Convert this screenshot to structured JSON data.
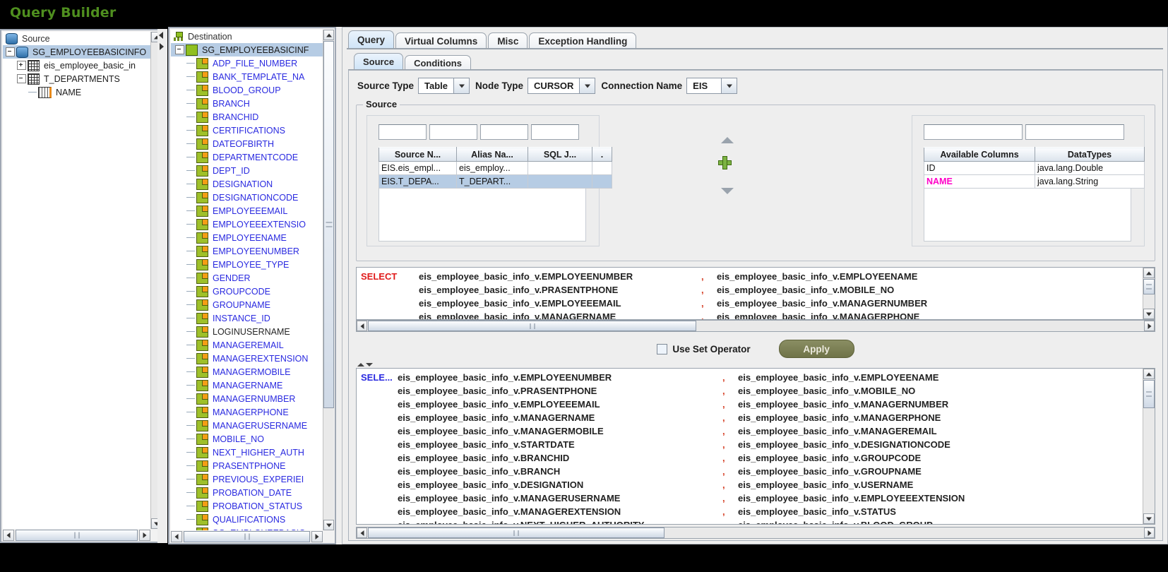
{
  "window": {
    "title": "Query Builder",
    "title_color": "#4f8f1f"
  },
  "source_panel": {
    "header": "Source",
    "nodes": [
      {
        "label": "SG_EMPLOYEEBASICINFO",
        "icon": "database-icon",
        "depth": 1,
        "expander": "minus",
        "selected": true
      },
      {
        "label": "eis_employee_basic_in",
        "icon": "table-icon",
        "depth": 2,
        "expander": "plus",
        "selected": false
      },
      {
        "label": "T_DEPARTMENTS",
        "icon": "table-icon",
        "depth": 2,
        "expander": "minus",
        "selected": false
      },
      {
        "label": "NAME",
        "icon": "column-icon",
        "depth": 3,
        "expander": "none",
        "selected": false
      }
    ]
  },
  "destination_panel": {
    "header": "Destination",
    "root": {
      "label": "SG_EMPLOYEEBASICINF",
      "selected": true
    },
    "columns": [
      {
        "label": "ADP_FILE_NUMBER",
        "color": "blue"
      },
      {
        "label": "BANK_TEMPLATE_NA",
        "color": "blue"
      },
      {
        "label": "BLOOD_GROUP",
        "color": "blue"
      },
      {
        "label": "BRANCH",
        "color": "blue"
      },
      {
        "label": "BRANCHID",
        "color": "blue"
      },
      {
        "label": "CERTIFICATIONS",
        "color": "blue"
      },
      {
        "label": "DATEOFBIRTH",
        "color": "blue"
      },
      {
        "label": "DEPARTMENTCODE",
        "color": "blue"
      },
      {
        "label": "DEPT_ID",
        "color": "blue"
      },
      {
        "label": "DESIGNATION",
        "color": "blue"
      },
      {
        "label": "DESIGNATIONCODE",
        "color": "blue"
      },
      {
        "label": "EMPLOYEEEMAIL",
        "color": "blue"
      },
      {
        "label": "EMPLOYEEEXTENSIO",
        "color": "blue"
      },
      {
        "label": "EMPLOYEENAME",
        "color": "blue"
      },
      {
        "label": "EMPLOYEENUMBER",
        "color": "blue"
      },
      {
        "label": "EMPLOYEE_TYPE",
        "color": "blue"
      },
      {
        "label": "GENDER",
        "color": "blue"
      },
      {
        "label": "GROUPCODE",
        "color": "blue"
      },
      {
        "label": "GROUPNAME",
        "color": "blue"
      },
      {
        "label": "INSTANCE_ID",
        "color": "blue"
      },
      {
        "label": "LOGINUSERNAME",
        "color": "black"
      },
      {
        "label": "MANAGEREMAIL",
        "color": "blue"
      },
      {
        "label": "MANAGEREXTENSION",
        "color": "blue"
      },
      {
        "label": "MANAGERMOBILE",
        "color": "blue"
      },
      {
        "label": "MANAGERNAME",
        "color": "blue"
      },
      {
        "label": "MANAGERNUMBER",
        "color": "blue"
      },
      {
        "label": "MANAGERPHONE",
        "color": "blue"
      },
      {
        "label": "MANAGERUSERNAME",
        "color": "blue"
      },
      {
        "label": "MOBILE_NO",
        "color": "blue"
      },
      {
        "label": "NEXT_HIGHER_AUTH",
        "color": "blue"
      },
      {
        "label": "PRASENTPHONE",
        "color": "blue"
      },
      {
        "label": "PREVIOUS_EXPERIEI",
        "color": "blue"
      },
      {
        "label": "PROBATION_DATE",
        "color": "blue"
      },
      {
        "label": "PROBATION_STATUS",
        "color": "blue"
      },
      {
        "label": "QUALIFICATIONS",
        "color": "blue"
      },
      {
        "label": "SG_EMPLOYEEBASIC",
        "color": "blue"
      }
    ]
  },
  "main": {
    "tabs": [
      {
        "label": "Query",
        "active": true
      },
      {
        "label": "Virtual Columns",
        "active": false
      },
      {
        "label": "Misc",
        "active": false
      },
      {
        "label": "Exception Handling",
        "active": false
      }
    ],
    "subtabs": [
      {
        "label": "Source",
        "active": true
      },
      {
        "label": "Conditions",
        "active": false
      }
    ],
    "controls": {
      "source_type_label": "Source Type",
      "source_type_value": "Table",
      "node_type_label": "Node Type",
      "node_type_value": "CURSOR",
      "connection_name_label": "Connection Name",
      "connection_name_value": "EIS"
    },
    "group_caption": "Source",
    "source_table": {
      "filters": [
        "",
        "",
        "",
        ""
      ],
      "headers": [
        "Source N...",
        "Alias Na...",
        "SQL J...",
        "."
      ],
      "rows": [
        {
          "cells": [
            "EIS.eis_empl...",
            "eis_employ...",
            "",
            ""
          ],
          "selected": false
        },
        {
          "cells": [
            "EIS.T_DEPA...",
            "T_DEPART...",
            "",
            ""
          ],
          "selected": true
        }
      ]
    },
    "available_table": {
      "filters": [
        "",
        ""
      ],
      "headers": [
        "Available Columns",
        "DataTypes"
      ],
      "rows": [
        {
          "cells": [
            "ID",
            "java.lang.Double"
          ],
          "highlight": false
        },
        {
          "cells": [
            "NAME",
            "java.lang.String"
          ],
          "highlight": true
        }
      ]
    },
    "mid_buttons": [
      "up-arrow-button",
      "add-button",
      "down-arrow-button"
    ],
    "use_set_operator_label": "Use Set Operator",
    "use_set_operator_checked": false,
    "apply_label": "Apply"
  },
  "sql_preview": {
    "keyword": "SELECT",
    "keyword_color": "#e01b1b",
    "left_column": [
      "eis_employee_basic_info_v.EMPLOYEENUMBER",
      "eis_employee_basic_info_v.PRASENTPHONE",
      "eis_employee_basic_info_v.EMPLOYEEEMAIL",
      "eis_employee_basic_info_v.MANAGERNAME"
    ],
    "right_column": [
      "eis_employee_basic_info_v.EMPLOYEENAME",
      "eis_employee_basic_info_v.MOBILE_NO",
      "eis_employee_basic_info_v.MANAGERNUMBER",
      "eis_employee_basic_info_v.MANAGERPHONE"
    ],
    "separator": ","
  },
  "sql_full": {
    "keyword": "SELE...",
    "keyword_color": "#2a2ae0",
    "separator": ",",
    "left_column": [
      "eis_employee_basic_info_v.EMPLOYEENUMBER",
      "eis_employee_basic_info_v.PRASENTPHONE",
      "eis_employee_basic_info_v.EMPLOYEEEMAIL",
      "eis_employee_basic_info_v.MANAGERNAME",
      "eis_employee_basic_info_v.MANAGERMOBILE",
      "eis_employee_basic_info_v.STARTDATE",
      "eis_employee_basic_info_v.BRANCHID",
      "eis_employee_basic_info_v.BRANCH",
      "eis_employee_basic_info_v.DESIGNATION",
      "eis_employee_basic_info_v.MANAGERUSERNAME",
      "eis_employee_basic_info_v.MANAGEREXTENSION",
      "eis_employee_basic_info_v.NEXT_HIGHER_AUTHORITY"
    ],
    "right_column": [
      "eis_employee_basic_info_v.EMPLOYEENAME",
      "eis_employee_basic_info_v.MOBILE_NO",
      "eis_employee_basic_info_v.MANAGERNUMBER",
      "eis_employee_basic_info_v.MANAGERPHONE",
      "eis_employee_basic_info_v.MANAGEREMAIL",
      "eis_employee_basic_info_v.DESIGNATIONCODE",
      "eis_employee_basic_info_v.GROUPCODE",
      "eis_employee_basic_info_v.GROUPNAME",
      "eis_employee_basic_info_v.USERNAME",
      "eis_employee_basic_info_v.EMPLOYEEEXTENSION",
      "eis_employee_basic_info_v.STATUS",
      "eis_employee_basic_info_v.BLOOD_GROUP"
    ]
  }
}
